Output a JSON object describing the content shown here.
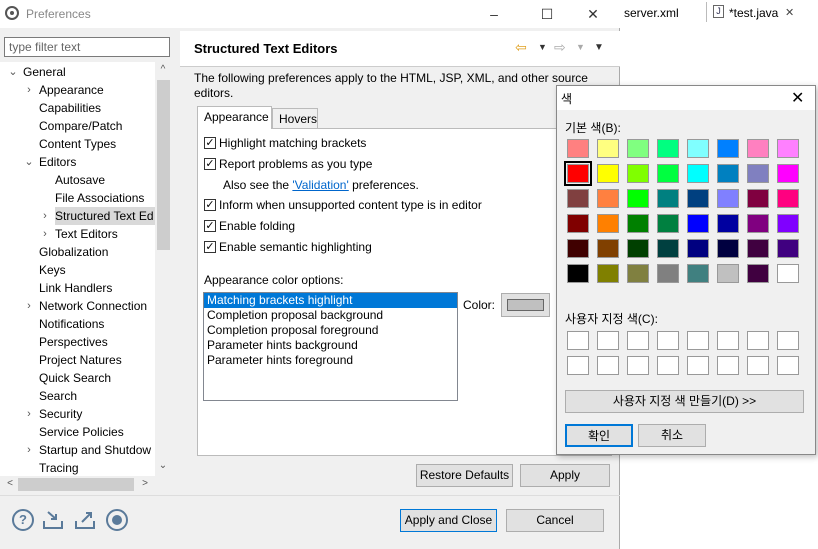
{
  "window": {
    "title": "Preferences",
    "minimize": "–",
    "maximize": "☐",
    "close": "✕"
  },
  "editor_tabs": [
    {
      "label": "server.xml",
      "icon": "xml-file-icon"
    },
    {
      "label": "*test.java",
      "icon": "java-file-icon",
      "close": "✕"
    }
  ],
  "filter": {
    "placeholder": "type filter text",
    "value": ""
  },
  "tree": [
    {
      "label": "General",
      "level": 0,
      "twisty": "⌄"
    },
    {
      "label": "Appearance",
      "level": 1,
      "twisty": "›"
    },
    {
      "label": "Capabilities",
      "level": 1,
      "twisty": ""
    },
    {
      "label": "Compare/Patch",
      "level": 1,
      "twisty": ""
    },
    {
      "label": "Content Types",
      "level": 1,
      "twisty": ""
    },
    {
      "label": "Editors",
      "level": 1,
      "twisty": "⌄"
    },
    {
      "label": "Autosave",
      "level": 2,
      "twisty": ""
    },
    {
      "label": "File Associations",
      "level": 2,
      "twisty": ""
    },
    {
      "label": "Structured Text Ed",
      "level": 2,
      "twisty": "›",
      "selected": true
    },
    {
      "label": "Text Editors",
      "level": 2,
      "twisty": "›"
    },
    {
      "label": "Globalization",
      "level": 1,
      "twisty": ""
    },
    {
      "label": "Keys",
      "level": 1,
      "twisty": ""
    },
    {
      "label": "Link Handlers",
      "level": 1,
      "twisty": ""
    },
    {
      "label": "Network Connection",
      "level": 1,
      "twisty": "›"
    },
    {
      "label": "Notifications",
      "level": 1,
      "twisty": ""
    },
    {
      "label": "Perspectives",
      "level": 1,
      "twisty": ""
    },
    {
      "label": "Project Natures",
      "level": 1,
      "twisty": ""
    },
    {
      "label": "Quick Search",
      "level": 1,
      "twisty": ""
    },
    {
      "label": "Search",
      "level": 1,
      "twisty": ""
    },
    {
      "label": "Security",
      "level": 1,
      "twisty": "›"
    },
    {
      "label": "Service Policies",
      "level": 1,
      "twisty": ""
    },
    {
      "label": "Startup and Shutdow",
      "level": 1,
      "twisty": "›"
    },
    {
      "label": "Tracing",
      "level": 1,
      "twisty": ""
    }
  ],
  "page": {
    "title": "Structured Text Editors",
    "description": "The following preferences apply to the HTML, JSP, XML, and other source editors.",
    "tabs": [
      "Appearance",
      "Hovers"
    ],
    "checkboxes": [
      {
        "label": "Highlight matching brackets",
        "checked": true
      },
      {
        "label": "Report problems as you type",
        "checked": true
      },
      {
        "label": "Inform when unsupported content type is in editor",
        "checked": true
      },
      {
        "label": "Enable folding",
        "checked": true
      },
      {
        "label": "Enable semantic highlighting",
        "checked": true
      }
    ],
    "see_also_prefix": "Also see the ",
    "see_also_link": "'Validation'",
    "see_also_suffix": " preferences.",
    "color_options_label": "Appearance color options:",
    "color_options": [
      "Matching brackets highlight",
      "Completion proposal background",
      "Completion proposal foreground",
      "Parameter hints background",
      "Parameter hints foreground"
    ],
    "color_label": "Color:",
    "restore_defaults": "Restore Defaults",
    "apply": "Apply"
  },
  "footer": {
    "apply_and_close": "Apply and Close",
    "cancel": "Cancel"
  },
  "color_dialog": {
    "title": "색",
    "basic_label": "기본 색(B):",
    "custom_label": "사용자 지정 색(C):",
    "define_custom": "사용자 지정 색 만들기(D) >>",
    "ok": "확인",
    "cancel": "취소",
    "basic_colors": [
      [
        "#ff8080",
        "#ffff80",
        "#80ff80",
        "#00ff80",
        "#80ffff",
        "#0080ff",
        "#ff80c0",
        "#ff80ff"
      ],
      [
        "#ff0000",
        "#ffff00",
        "#80ff00",
        "#00ff40",
        "#00ffff",
        "#0080c0",
        "#8080c0",
        "#ff00ff"
      ],
      [
        "#804040",
        "#ff8040",
        "#00ff00",
        "#008080",
        "#004080",
        "#8080ff",
        "#800040",
        "#ff0080"
      ],
      [
        "#800000",
        "#ff8000",
        "#008000",
        "#008040",
        "#0000ff",
        "#0000a0",
        "#800080",
        "#8000ff"
      ],
      [
        "#400000",
        "#804000",
        "#004000",
        "#004040",
        "#000080",
        "#000040",
        "#400040",
        "#400080"
      ],
      [
        "#000000",
        "#808000",
        "#808040",
        "#808080",
        "#408080",
        "#c0c0c0",
        "#400040",
        "#ffffff"
      ]
    ],
    "selected": [
      1,
      0
    ]
  }
}
